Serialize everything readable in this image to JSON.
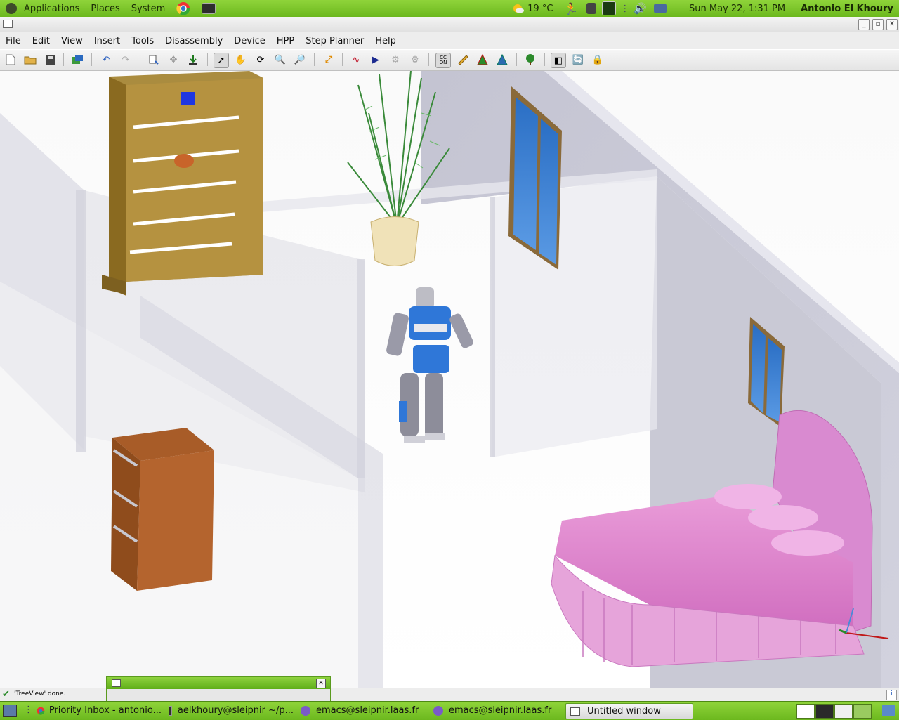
{
  "top_panel": {
    "menus": [
      "Applications",
      "Places",
      "System"
    ],
    "launchers": [
      "chrome-icon",
      "terminal-icon"
    ],
    "weather": "19 °C",
    "datetime": "Sun May 22,  1:31 PM",
    "user": "Antonio El Khoury"
  },
  "menubar": [
    "File",
    "Edit",
    "View",
    "Insert",
    "Tools",
    "Disassembly",
    "Device",
    "HPP",
    "Step Planner",
    "Help"
  ],
  "toolbar": {
    "icons": [
      "new-icon",
      "open-icon",
      "save-icon",
      "export-icon",
      "undo-icon",
      "redo-icon",
      "tree-icon",
      "move-icon",
      "place-icon",
      "select-icon",
      "pan-icon",
      "rotate-icon",
      "zoom-icon",
      "zoom-fit-icon",
      "scale-icon",
      "path-icon",
      "play-icon",
      "step-icon",
      "record-icon",
      "collision-icon",
      "ruler-icon",
      "roadmap-icon",
      "roadmap-alt-icon",
      "tree-green-icon",
      "view-all-icon",
      "refresh-icon",
      "lock-icon"
    ],
    "active": [
      "select-icon",
      "collision-icon",
      "view-all-icon"
    ]
  },
  "status": {
    "text": "'TreeView' done."
  },
  "taskbar": {
    "tasks": [
      {
        "label": "Priority Inbox - antonio...",
        "icon": "chrome-icon"
      },
      {
        "label": "aelkhoury@sleipnir ~/p...",
        "icon": "terminal-icon"
      },
      {
        "label": "emacs@sleipnir.laas.fr",
        "icon": "emacs-icon"
      },
      {
        "label": "emacs@sleipnir.laas.fr",
        "icon": "emacs-icon"
      },
      {
        "label": "Untitled window",
        "icon": "window-icon"
      }
    ]
  },
  "colors": {
    "panel": "#7ac42a",
    "wall": "#c9c9d6",
    "wood": "#9c7a2f",
    "bed": "#e58fd1",
    "robot_blue": "#2f77d8"
  }
}
